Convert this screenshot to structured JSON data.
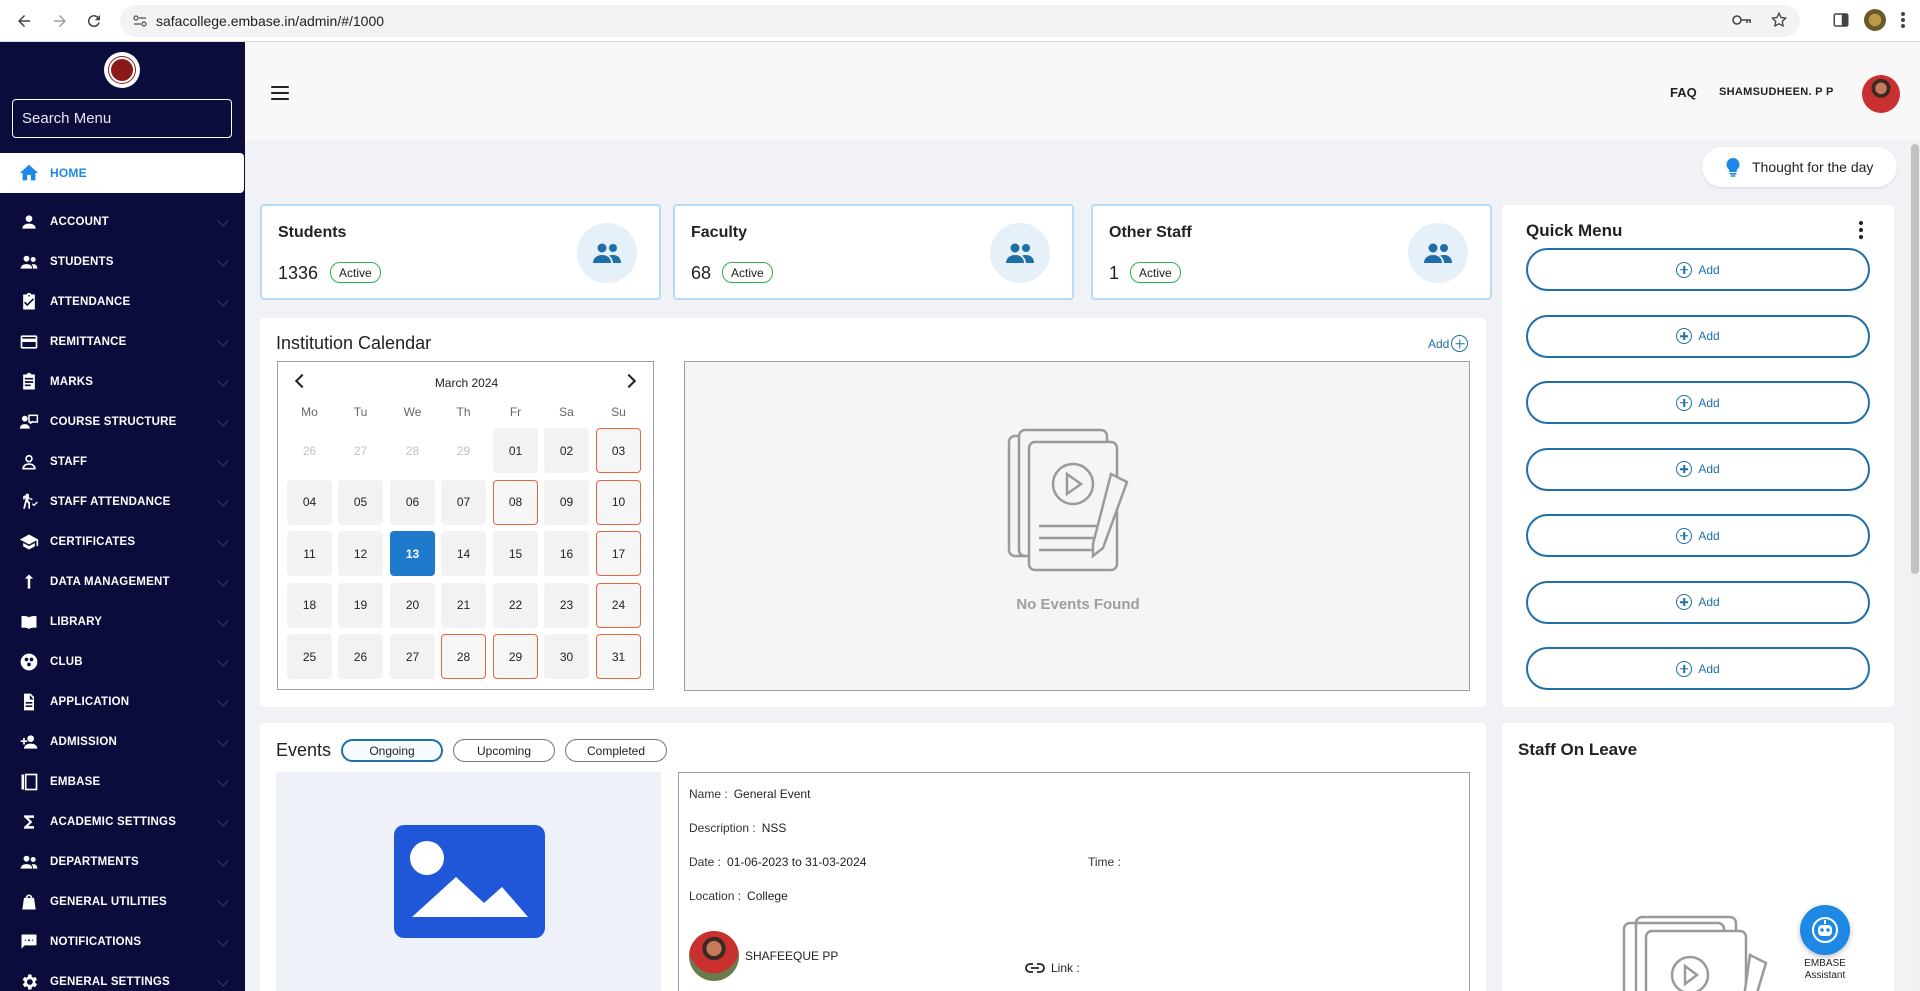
{
  "browser": {
    "url": "safacollege.embase.in/admin/#/1000"
  },
  "sidebar": {
    "search_placeholder": "Search Menu",
    "home_label": "HOME",
    "items": [
      {
        "label": "ACCOUNT",
        "icon": "person-icon"
      },
      {
        "label": "STUDENTS",
        "icon": "people-icon"
      },
      {
        "label": "ATTENDANCE",
        "icon": "assignment-check-icon"
      },
      {
        "label": "REMITTANCE",
        "icon": "payment-card-icon"
      },
      {
        "label": "MARKS",
        "icon": "clipboard-icon"
      },
      {
        "label": "COURSE STRUCTURE",
        "icon": "teacher-icon"
      },
      {
        "label": "STAFF",
        "icon": "person-outline-icon"
      },
      {
        "label": "STAFF ATTENDANCE",
        "icon": "walk-icon"
      },
      {
        "label": "CERTIFICATES",
        "icon": "school-icon"
      },
      {
        "label": "DATA MANAGEMENT",
        "icon": "upload-icon"
      },
      {
        "label": "LIBRARY",
        "icon": "book-icon"
      },
      {
        "label": "CLUB",
        "icon": "club-icon"
      },
      {
        "label": "APPLICATION",
        "icon": "document-icon"
      },
      {
        "label": "ADMISSION",
        "icon": "person-add-icon"
      },
      {
        "label": "EMBASE",
        "icon": "embase-icon"
      },
      {
        "label": "ACADEMIC SETTINGS",
        "icon": "sigma-icon"
      },
      {
        "label": "DEPARTMENTS",
        "icon": "groups-icon"
      },
      {
        "label": "GENERAL UTILITIES",
        "icon": "bag-icon"
      },
      {
        "label": "NOTIFICATIONS",
        "icon": "message-icon"
      },
      {
        "label": "GENERAL SETTINGS",
        "icon": "settings-icon"
      }
    ]
  },
  "header": {
    "faq": "FAQ",
    "username": "SHAMSUDHEEN. P P"
  },
  "thought": {
    "label": "Thought for the day"
  },
  "stats": [
    {
      "title": "Students",
      "count": "1336",
      "badge": "Active"
    },
    {
      "title": "Faculty",
      "count": "68",
      "badge": "Active"
    },
    {
      "title": "Other Staff",
      "count": "1",
      "badge": "Active"
    }
  ],
  "quick_menu": {
    "title": "Quick Menu",
    "buttons": [
      "Add",
      "Add",
      "Add",
      "Add",
      "Add",
      "Add",
      "Add"
    ]
  },
  "calendar": {
    "title": "Institution Calendar",
    "add_label": "Add",
    "month": "March 2024",
    "dow": [
      "Mo",
      "Tu",
      "We",
      "Th",
      "Fr",
      "Sa",
      "Su"
    ],
    "weeks": [
      [
        {
          "d": "26",
          "t": "muted"
        },
        {
          "d": "27",
          "t": "muted"
        },
        {
          "d": "28",
          "t": "muted"
        },
        {
          "d": "29",
          "t": "muted"
        },
        {
          "d": "01",
          "t": ""
        },
        {
          "d": "02",
          "t": ""
        },
        {
          "d": "03",
          "t": "holiday"
        }
      ],
      [
        {
          "d": "04",
          "t": ""
        },
        {
          "d": "05",
          "t": ""
        },
        {
          "d": "06",
          "t": ""
        },
        {
          "d": "07",
          "t": ""
        },
        {
          "d": "08",
          "t": "holiday"
        },
        {
          "d": "09",
          "t": ""
        },
        {
          "d": "10",
          "t": "holiday"
        }
      ],
      [
        {
          "d": "11",
          "t": ""
        },
        {
          "d": "12",
          "t": ""
        },
        {
          "d": "13",
          "t": "today"
        },
        {
          "d": "14",
          "t": ""
        },
        {
          "d": "15",
          "t": ""
        },
        {
          "d": "16",
          "t": ""
        },
        {
          "d": "17",
          "t": "holiday"
        }
      ],
      [
        {
          "d": "18",
          "t": ""
        },
        {
          "d": "19",
          "t": ""
        },
        {
          "d": "20",
          "t": ""
        },
        {
          "d": "21",
          "t": ""
        },
        {
          "d": "22",
          "t": ""
        },
        {
          "d": "23",
          "t": ""
        },
        {
          "d": "24",
          "t": "holiday"
        }
      ],
      [
        {
          "d": "25",
          "t": ""
        },
        {
          "d": "26",
          "t": ""
        },
        {
          "d": "27",
          "t": ""
        },
        {
          "d": "28",
          "t": "holiday"
        },
        {
          "d": "29",
          "t": "holiday"
        },
        {
          "d": "30",
          "t": ""
        },
        {
          "d": "31",
          "t": "holiday"
        }
      ]
    ],
    "no_events": "No Events Found"
  },
  "events": {
    "title": "Events",
    "tabs": [
      "Ongoing",
      "Upcoming",
      "Completed"
    ],
    "active_tab": "Ongoing",
    "name_label": "Name :",
    "name": "General Event",
    "description_label": "Description :",
    "description": "NSS",
    "date_label": "Date :",
    "date": "01-06-2023 to 31-03-2024",
    "time_label": "Time :",
    "location_label": "Location :",
    "location": "College",
    "person": "SHAFEEQUE PP",
    "link_label": "Link :"
  },
  "staff_on_leave": {
    "title": "Staff On Leave"
  },
  "assistant": {
    "label_line1": "EMBASE",
    "label_line2": "Assistant"
  },
  "colors": {
    "sidebar_bg": "#0c0c3c",
    "accent": "#1e88e5",
    "primary": "#1e6fa8",
    "holiday_border": "#e8663d",
    "active_badge": "#2fb344"
  }
}
